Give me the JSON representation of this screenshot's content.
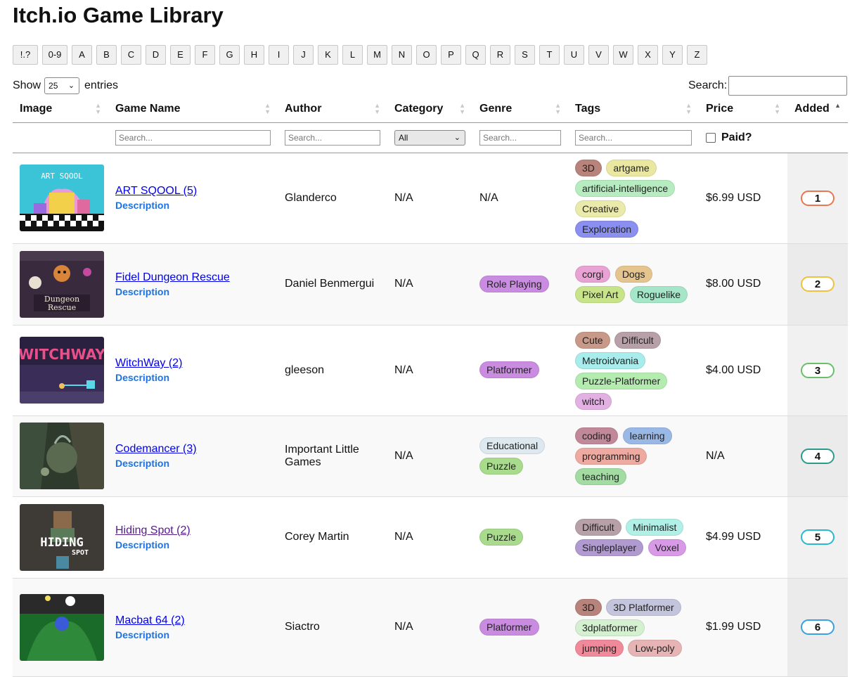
{
  "title": "Itch.io Game Library",
  "alphabet": [
    "!.?",
    "0-9",
    "A",
    "B",
    "C",
    "D",
    "E",
    "F",
    "G",
    "H",
    "I",
    "J",
    "K",
    "L",
    "M",
    "N",
    "O",
    "P",
    "Q",
    "R",
    "S",
    "T",
    "U",
    "V",
    "W",
    "X",
    "Y",
    "Z"
  ],
  "controls": {
    "show_label": "Show",
    "show_value": "25",
    "entries_label": "entries",
    "search_label": "Search:"
  },
  "columns": [
    "Image",
    "Game Name",
    "Author",
    "Category",
    "Genre",
    "Tags",
    "Price",
    "Added"
  ],
  "filters": {
    "placeholder": "Search...",
    "category_value": "All",
    "paid_label": "Paid?"
  },
  "icons": {
    "sort": "sort-icon",
    "chevron": "chevron-down-icon"
  },
  "rows": [
    {
      "name": "ART SQOOL (5)",
      "description": "Description",
      "author": "Glanderco",
      "category": "N/A",
      "genre_text": "N/A",
      "genres": [],
      "tags": [
        {
          "t": "3D",
          "c": "#b8837a"
        },
        {
          "t": "artgame",
          "c": "#eae8a0"
        },
        {
          "t": "artificial-intelligence",
          "c": "#b6ecc0"
        },
        {
          "t": "Creative",
          "c": "#eaeaaa"
        },
        {
          "t": "Exploration",
          "c": "#8a8ff0"
        }
      ],
      "price": "$6.99 USD",
      "added": "1",
      "color": "#e8774f",
      "thumb": "art"
    },
    {
      "name": "Fidel Dungeon Rescue",
      "description": "Description",
      "author": "Daniel Benmergui",
      "category": "N/A",
      "genre_text": "",
      "genres": [
        {
          "t": "Role Playing",
          "c": "#c98ce0"
        }
      ],
      "tags": [
        {
          "t": "corgi",
          "c": "#e8a2d4"
        },
        {
          "t": "Dogs",
          "c": "#e6c48e"
        },
        {
          "t": "Pixel Art",
          "c": "#c8e48a"
        },
        {
          "t": "Roguelike",
          "c": "#a6e6c8"
        }
      ],
      "price": "$8.00 USD",
      "added": "2",
      "color": "#eec23c",
      "thumb": "dungeon"
    },
    {
      "name": "WitchWay (2)",
      "description": "Description",
      "author": "gleeson",
      "category": "N/A",
      "genre_text": "",
      "genres": [
        {
          "t": "Platformer",
          "c": "#c98ce0"
        }
      ],
      "tags": [
        {
          "t": "Cute",
          "c": "#c89888"
        },
        {
          "t": "Difficult",
          "c": "#b8a0a8"
        },
        {
          "t": "Metroidvania",
          "c": "#a8ecec"
        },
        {
          "t": "Puzzle-Platformer",
          "c": "#b4ecb0"
        },
        {
          "t": "witch",
          "c": "#e2b0e2"
        }
      ],
      "price": "$4.00 USD",
      "added": "3",
      "color": "#6abf6a",
      "thumb": "witch"
    },
    {
      "name": "Codemancer (3)",
      "description": "Description",
      "author": "Important Little Games",
      "category": "N/A",
      "genre_text": "",
      "genres": [
        {
          "t": "Educational",
          "c": "#dde9ee"
        },
        {
          "t": "Puzzle",
          "c": "#a8dc8c"
        }
      ],
      "tags": [
        {
          "t": "coding",
          "c": "#c08898"
        },
        {
          "t": "learning",
          "c": "#9ab8e6"
        },
        {
          "t": "programming",
          "c": "#eeaaa0"
        },
        {
          "t": "teaching",
          "c": "#a2dca2"
        }
      ],
      "price": "N/A",
      "added": "4",
      "color": "#2e9a8a",
      "thumb": "code"
    },
    {
      "name": "Hiding Spot (2)",
      "description": "Description",
      "author": "Corey Martin",
      "category": "N/A",
      "genre_text": "",
      "genres": [
        {
          "t": "Puzzle",
          "c": "#a8dc8c"
        }
      ],
      "tags": [
        {
          "t": "Difficult",
          "c": "#b8a0a8"
        },
        {
          "t": "Minimalist",
          "c": "#b0f0e6"
        },
        {
          "t": "Singleplayer",
          "c": "#b09ad0"
        },
        {
          "t": "Voxel",
          "c": "#d89ae6"
        }
      ],
      "price": "$4.99 USD",
      "added": "5",
      "color": "#2ab8d0",
      "thumb": "hiding",
      "visited": true
    },
    {
      "name": "Macbat 64 (2)",
      "description": "Description",
      "author": "Siactro",
      "category": "N/A",
      "genre_text": "",
      "genres": [
        {
          "t": "Platformer",
          "c": "#c98ce0"
        }
      ],
      "tags": [
        {
          "t": "3D",
          "c": "#b8837a"
        },
        {
          "t": "3D Platformer",
          "c": "#c4c4dc"
        },
        {
          "t": "3dplatformer",
          "c": "#d4f0d0"
        },
        {
          "t": "jumping",
          "c": "#f08a9a"
        },
        {
          "t": "Low-poly",
          "c": "#e6b4b4"
        }
      ],
      "price": "$1.99 USD",
      "added": "6",
      "color": "#3aa0e0",
      "thumb": "macbat"
    }
  ]
}
